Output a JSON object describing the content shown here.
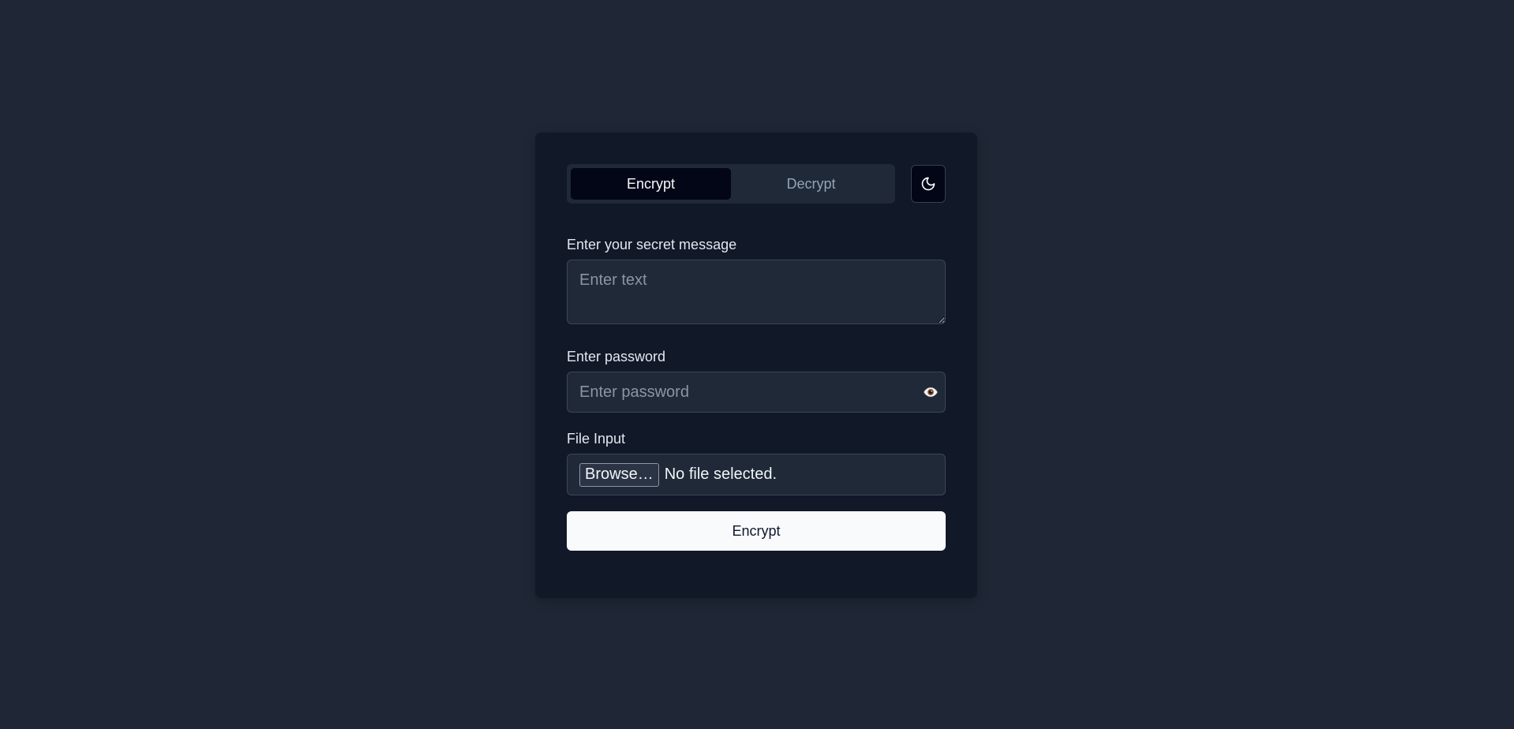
{
  "tabs": [
    {
      "label": "Encrypt",
      "active": true
    },
    {
      "label": "Decrypt",
      "active": false
    }
  ],
  "theme_toggle": {
    "icon": "moon-icon"
  },
  "message": {
    "label": "Enter your secret message",
    "placeholder": "Enter text",
    "value": ""
  },
  "password": {
    "label": "Enter password",
    "placeholder": "Enter password",
    "value": "",
    "toggle_icon": "eye-icon"
  },
  "file": {
    "label": "File Input",
    "button_label": "Browse…",
    "status": "No file selected."
  },
  "submit": {
    "label": "Encrypt"
  },
  "colors": {
    "page_bg": "#1f2736",
    "card_bg": "#111827",
    "field_bg": "#1f2937",
    "active_tab_bg": "#020617",
    "primary_button_bg": "#f8fafc"
  }
}
